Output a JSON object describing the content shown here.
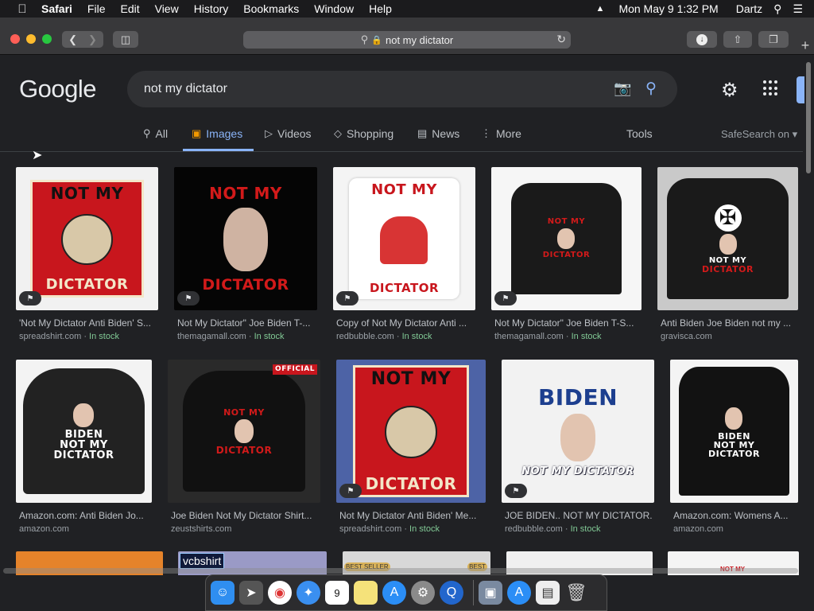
{
  "menubar": {
    "app": "Safari",
    "items": [
      "File",
      "Edit",
      "View",
      "History",
      "Bookmarks",
      "Window",
      "Help"
    ],
    "datetime": "Mon May 9  1:32 PM",
    "user": "Dartz"
  },
  "browser": {
    "url": "not my dictator"
  },
  "google": {
    "logo": "Google",
    "query": "not my dictator",
    "tabs": [
      {
        "label": "All",
        "icon": "search-icon"
      },
      {
        "label": "Images",
        "icon": "image-icon"
      },
      {
        "label": "Videos",
        "icon": "play-icon"
      },
      {
        "label": "Shopping",
        "icon": "tag-icon"
      },
      {
        "label": "News",
        "icon": "news-icon"
      },
      {
        "label": "More",
        "icon": "dots-icon"
      }
    ],
    "tools": "Tools",
    "safesearch": "SafeSearch on"
  },
  "results": [
    {
      "title": "'Not My Dictator Anti Biden' S...",
      "source": "spreadshirt.com",
      "stock": "In stock",
      "img_text": [
        "NOT MY",
        "DICTATOR"
      ]
    },
    {
      "title": "Not My Dictator\" Joe Biden T-...",
      "source": "themagamall.com",
      "stock": "In stock",
      "img_text": [
        "NOT MY",
        "DICTATOR"
      ]
    },
    {
      "title": "Copy of Not My Dictator Anti ...",
      "source": "redbubble.com",
      "stock": "In stock",
      "img_text": [
        "NOT MY",
        "DICTATOR"
      ]
    },
    {
      "title": "Not My Dictator\" Joe Biden T-S...",
      "source": "themagamall.com",
      "stock": "In stock",
      "img_text": [
        "NOT MY",
        "DICTATOR"
      ]
    },
    {
      "title": "Anti Biden Joe Biden not my ...",
      "source": "gravisca.com",
      "stock": "",
      "img_text": [
        "NOT MY",
        "DICTATOR"
      ]
    },
    {
      "title": "Amazon.com: Anti Biden Jo...",
      "source": "amazon.com",
      "stock": "",
      "img_text": [
        "BIDEN",
        "NOT MY",
        "DICTATOR"
      ]
    },
    {
      "title": "Joe Biden Not My Dictator Shirt...",
      "source": "zeustshirts.com",
      "stock": "",
      "img_text": [
        "NOT MY",
        "DICTATOR",
        "OFFICIAL"
      ]
    },
    {
      "title": "Not My Dictator Anti Biden' Me...",
      "source": "spreadshirt.com",
      "stock": "In stock",
      "img_text": [
        "NOT MY",
        "DICTATOR"
      ]
    },
    {
      "title": "JOE BIDEN.. NOT MY DICTATOR...",
      "source": "redbubble.com",
      "stock": "In stock",
      "img_text": [
        "BIDEN",
        "NOT MY DICTATOR"
      ]
    },
    {
      "title": "Amazon.com: Womens A...",
      "source": "amazon.com",
      "stock": "",
      "img_text": [
        "BIDEN",
        "NOT MY",
        "DICTATOR"
      ]
    }
  ],
  "peek": {
    "label": "vcbshirt",
    "badge1": "BEST SELLER",
    "badge2": "BEST",
    "text": "NOT MY"
  },
  "colors": {
    "accent": "#8ab4f8",
    "instock": "#81c995",
    "bg": "#202124"
  }
}
